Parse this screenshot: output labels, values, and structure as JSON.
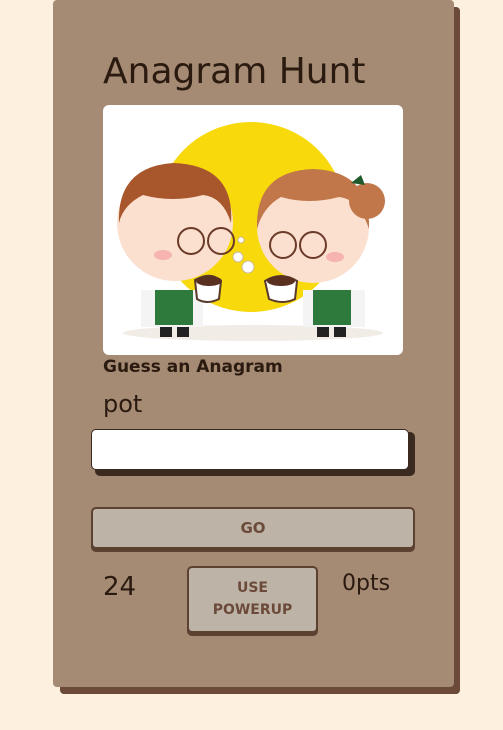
{
  "game": {
    "title": "Anagram Hunt",
    "prompt_label": "Guess an Anagram",
    "current_word": "pot",
    "answer_input": {
      "value": "",
      "placeholder": ""
    },
    "go_label": "GO",
    "powerup_label_line1": "USE",
    "powerup_label_line2": "POWERUP",
    "timer": "24",
    "score": "0pts",
    "image_description_icon": "two-baristas-coffee-illustration"
  },
  "colors": {
    "page_background": "#fdf0df",
    "card_background": "#a58a74",
    "card_shadow": "#6b4a3a",
    "button_background": "#bdb3a6",
    "button_text": "#6b4a3a",
    "text": "#2a1a0f",
    "sun_yellow": "#f7d90c",
    "apron_green": "#2e7a3c"
  }
}
